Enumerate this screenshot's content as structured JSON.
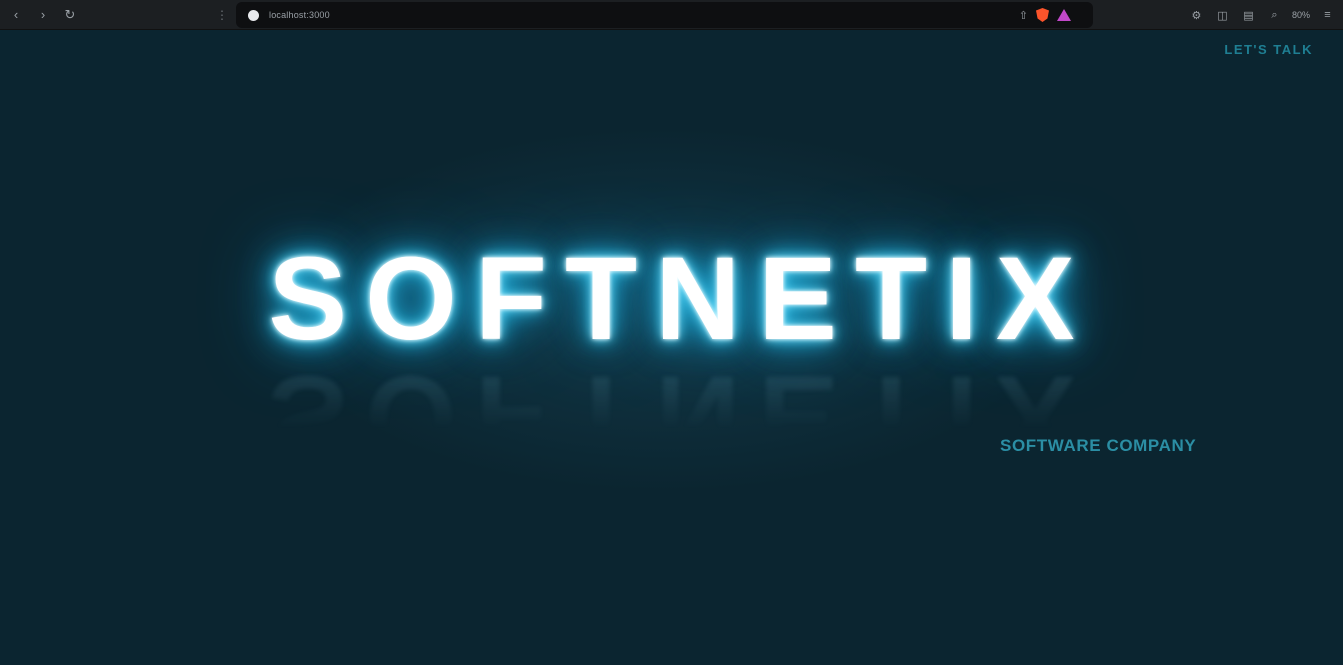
{
  "browser": {
    "url": "localhost:3000",
    "zoom": "80%"
  },
  "page": {
    "cta_label": "LET'S TALK",
    "brand": "SOFTNETIX",
    "tagline": "SOFTWARE COMPANY"
  },
  "colors": {
    "background": "#0b2530",
    "glow": "#2fc9f5",
    "accent": "#2b8ea4"
  }
}
